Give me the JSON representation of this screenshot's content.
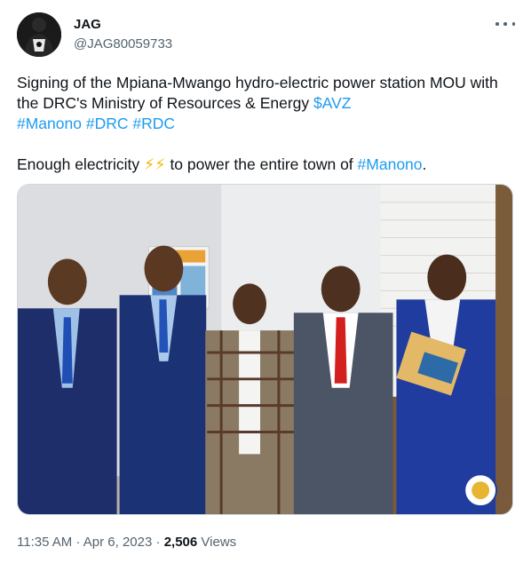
{
  "tweet": {
    "author_name": "JAG",
    "author_handle": "@JAG80059733",
    "line1": "Signing of the Mpiana-Mwango hydro-electric power station MOU with the DRC's Ministry of Resources & Energy ",
    "tag_avz": "$AVZ",
    "tag_manono": "#Manono",
    "tag_drc": "#DRC",
    "tag_rdc": "#RDC",
    "line2_start": "Enough electricity ",
    "bolts": "⚡⚡",
    "line2_mid": " to power the entire town of ",
    "tag_manono2": "#Manono",
    "line2_end": ".",
    "time": "11:35 AM",
    "separator": "·",
    "date": "Apr 6, 2023",
    "views_count": "2,506",
    "views_label": "Views"
  },
  "icons": {
    "more": "more-horizontal-icon",
    "avatar": "avatar-image"
  },
  "colors": {
    "link": "#1d9bf0",
    "text": "#0f1419",
    "secondary": "#536471"
  }
}
